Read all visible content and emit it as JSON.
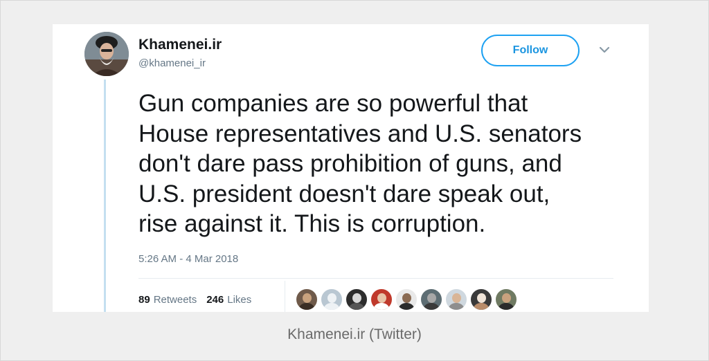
{
  "tweet": {
    "author_name": "Khamenei.ir",
    "author_handle": "@khamenei_ir",
    "follow_label": "Follow",
    "text": "Gun companies are so powerful that\nHouse representatives and U.S. senators\ndon't dare pass prohibition of guns, and\nU.S. president doesn't dare speak out,\nrise against it. This is corruption.",
    "timestamp": "5:26 AM - 4 Mar 2018",
    "retweets_count": "89",
    "retweets_label": "Retweets",
    "likes_count": "246",
    "likes_label": "Likes",
    "likers": [
      {
        "bg": "#6f5a4a",
        "face": "#c9a27e",
        "body": "#3b2e25"
      },
      {
        "bg": "#b9c7d2",
        "face": "#eef2f5",
        "body": "#eef2f5"
      },
      {
        "bg": "#2d2d2d",
        "face": "#d8d8d8",
        "body": "#555555"
      },
      {
        "bg": "#c0392b",
        "face": "#e8c4a8",
        "body": "#ffffff"
      },
      {
        "bg": "#e9e9e9",
        "face": "#8a6a52",
        "body": "#2b2b2b"
      },
      {
        "bg": "#5d6d73",
        "face": "#a7a7a7",
        "body": "#3a3a3a"
      },
      {
        "bg": "#cfd8df",
        "face": "#d9b596",
        "body": "#8e8e8e"
      },
      {
        "bg": "#3a3a3a",
        "face": "#f0e4d8",
        "body": "#b98c6a"
      },
      {
        "bg": "#6f7a62",
        "face": "#c9a27e",
        "body": "#2b2b2b"
      }
    ]
  },
  "caption": "Khamenei.ir (Twitter)",
  "colors": {
    "accent": "#1da1f2",
    "text": "#14171a",
    "secondary_text": "#657786"
  }
}
